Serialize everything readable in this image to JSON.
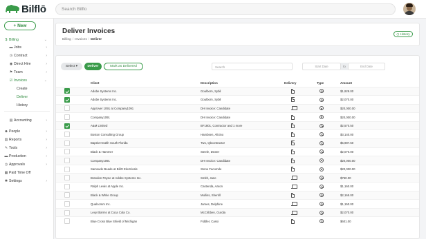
{
  "app": {
    "name": "Bilflō",
    "search_placeholder": "Search Bilflo"
  },
  "sidebar": {
    "new_label": "+ New",
    "items": [
      {
        "icon": "dollar-icon",
        "glyph": "$",
        "label": "Billing",
        "active": true,
        "chevron": "⌄",
        "indent": 0
      },
      {
        "icon": "briefcase-icon",
        "glyph": "▬",
        "label": "Jobs",
        "chevron": "›",
        "indent": 1
      },
      {
        "icon": "clock-icon",
        "glyph": "◷",
        "label": "Contract",
        "chevron": "›",
        "indent": 1
      },
      {
        "icon": "target-icon",
        "glyph": "◉",
        "label": "Direct Hire",
        "chevron": "›",
        "indent": 1
      },
      {
        "icon": "team-icon",
        "glyph": "⚑",
        "label": "Team",
        "chevron": "›",
        "indent": 1
      },
      {
        "icon": "invoice-icon",
        "glyph": "☑",
        "label": "Invoices",
        "active": true,
        "chevron": "⌄",
        "indent": 1
      },
      {
        "icon": "",
        "glyph": "",
        "label": "Create",
        "indent": 2
      },
      {
        "icon": "",
        "glyph": "",
        "label": "Deliver",
        "current": true,
        "indent": 2
      },
      {
        "icon": "",
        "glyph": "",
        "label": "History",
        "indent": 2
      },
      {
        "icon": "accounting-icon",
        "glyph": "▤",
        "label": "Accounting",
        "chevron": "›",
        "indent": 1
      },
      {
        "icon": "people-icon",
        "glyph": "☻",
        "label": "People",
        "chevron": "›",
        "indent": 0
      },
      {
        "icon": "reports-icon",
        "glyph": "▥",
        "label": "Reports",
        "chevron": "›",
        "indent": 0
      },
      {
        "icon": "tools-icon",
        "glyph": "✎",
        "label": "Tools",
        "chevron": "›",
        "indent": 0
      },
      {
        "icon": "production-icon",
        "glyph": "▬",
        "label": "Production",
        "chevron": "›",
        "indent": 0
      },
      {
        "icon": "approvals-icon",
        "glyph": "◷",
        "label": "Approvals",
        "chevron": "›",
        "indent": 0
      },
      {
        "icon": "calendar-icon",
        "glyph": "▦",
        "label": "Paid Time Off",
        "indent": 0
      },
      {
        "icon": "settings-icon",
        "glyph": "✱",
        "label": "Settings",
        "chevron": "›",
        "indent": 0
      }
    ]
  },
  "header": {
    "title": "Deliver Invoices",
    "breadcrumb": [
      "Billing",
      "Invoices",
      "Deliver"
    ],
    "history_label": "History"
  },
  "toolbar": {
    "select_label": "Select",
    "deliver_label": "Deliver",
    "mark_delivered_label": "Mark as Delivered",
    "search_placeholder": "Search",
    "start_date_placeholder": "Start Date",
    "to_label": "to",
    "end_date_placeholder": "End Date"
  },
  "table": {
    "columns": [
      "",
      "Client",
      "Description",
      "Delivery",
      "Type",
      "Amount"
    ],
    "rows": [
      {
        "checked": true,
        "client": "Adobe Systems Inc.",
        "description": "Goulborn, Sybil",
        "delivery": "doc",
        "type": "clock",
        "amount": "$1,929.00"
      },
      {
        "checked": true,
        "client": "Adobe Systems Inc.",
        "description": "Goulborn, Sybil",
        "delivery": "doc",
        "type": "clock",
        "amount": "$2,070.00"
      },
      {
        "checked": false,
        "client": "Approver 1091 at Company1091",
        "description": "DH Invoice: Candidate",
        "delivery": "laptop",
        "type": "fixed",
        "amount": "$20,000.00"
      },
      {
        "checked": false,
        "client": "Company1091",
        "description": "DH Invoice: Candidate",
        "delivery": "doc",
        "type": "fixed",
        "amount": "$20,000.00"
      },
      {
        "checked": true,
        "client": "A&M Limited",
        "description": "BF1801, Contractor and 1 more",
        "delivery": "doc",
        "type": "clock",
        "amount": "$2,570.50"
      },
      {
        "checked": false,
        "client": "Boston Consulting Group",
        "description": "Hambsen, Alicino",
        "delivery": "doc",
        "type": "clock",
        "amount": "$3,140.00"
      },
      {
        "checked": false,
        "client": "Baptist Health South Florida",
        "description": "Two, Qbcontractor",
        "delivery": "doc",
        "type": "clock",
        "amount": "$5,987.50"
      },
      {
        "checked": false,
        "client": "Black & Hammer",
        "description": "Steele, Dexter",
        "delivery": "doc",
        "type": "clock",
        "amount": "$2,070.00"
      },
      {
        "checked": false,
        "client": "Company1091",
        "description": "DH Invoice: Candidate",
        "delivery": "doc",
        "type": "fixed",
        "amount": "$20,000.00"
      },
      {
        "checked": false,
        "client": "Samsude Beade at BillO Electricals",
        "description": "Stone Facomde",
        "delivery": "doc",
        "type": "fixed",
        "amount": "$20,000.00"
      },
      {
        "checked": false,
        "client": "Brandon Payne at Adobe Systems Inc.",
        "description": "Smith, Jane",
        "delivery": "laptop",
        "type": "clock",
        "amount": "$750.00"
      },
      {
        "checked": false,
        "client": "Ralph Lewis at Apple Inc.",
        "description": "Castenda, Aaron",
        "delivery": "laptop",
        "type": "clock",
        "amount": "$1,160.00"
      },
      {
        "checked": false,
        "client": "Black & White Group",
        "description": "Mullins, Sherrill",
        "delivery": "doc",
        "type": "clock",
        "amount": "$2,165.00"
      },
      {
        "checked": false,
        "client": "Qualcomm Inc.",
        "description": "James, Delphine",
        "delivery": "laptop",
        "type": "clock",
        "amount": "$1,150.00"
      },
      {
        "checked": false,
        "client": "Lexy Blarms at Coca Cola Co.",
        "description": "McCribben, Gurdia",
        "delivery": "laptop",
        "type": "clock",
        "amount": "$2,070.00"
      },
      {
        "checked": false,
        "client": "Blue Cross Blue Shield of Michigan",
        "description": "Fiddler, Cassi",
        "delivery": "doc",
        "type": "clock",
        "amount": "$601.00"
      }
    ]
  },
  "colors": {
    "accent": "#3a9b4a",
    "accent_text": "#2e8a3e"
  }
}
